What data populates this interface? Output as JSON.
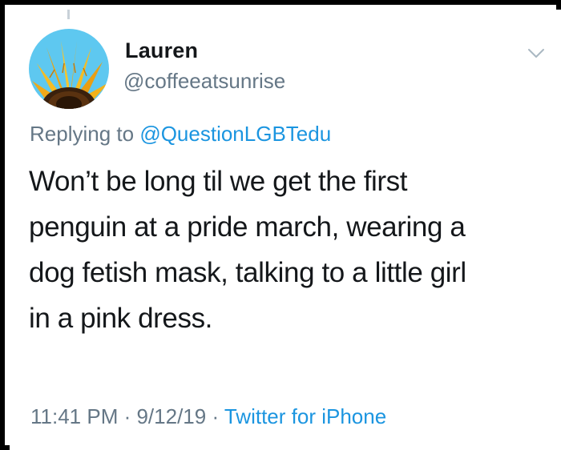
{
  "tweet": {
    "display_name": "Lauren",
    "handle": "@coffeeatsunrise",
    "replying_prefix": "Replying to ",
    "replying_to": "@QuestionLGBTedu",
    "text_lines": [
      "Won’t be long til we get the first",
      "penguin at a pride march, wearing a",
      "dog fetish mask, talking to a little girl",
      "in a pink dress."
    ],
    "time": "11:41 PM",
    "separator": " · ",
    "date": "9/12/19",
    "source": "Twitter for iPhone"
  },
  "icons": {
    "menu": "chevron-down-icon",
    "avatar": "sunflower-avatar"
  },
  "colors": {
    "text": "#14171a",
    "secondary": "#657786",
    "link": "#1b95e0",
    "sky": "#5ec8f0",
    "petal": "#f2b21a"
  }
}
